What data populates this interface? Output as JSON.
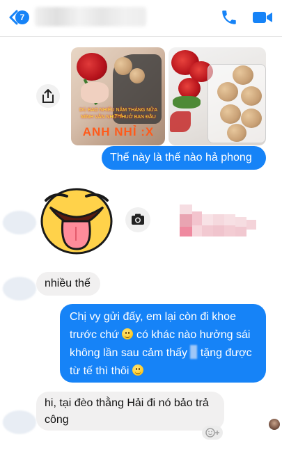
{
  "header": {
    "unread_count": "7",
    "contact_name": "",
    "icons": {
      "back": "chevron-left-icon",
      "call": "phone-icon",
      "video": "video-camera-icon"
    },
    "accent_color": "#1683f7"
  },
  "photo_message": {
    "overlay_line1": "DÙ BAO NHIÊU NĂM THÁNG NỮA THÌ",
    "overlay_line2": "MÌNH VẪN NHƯ THUỞ BAN ĐẦU",
    "overlay_title": "ANH NHỈ :X"
  },
  "messages": [
    {
      "side": "out",
      "text": "Thế này là thế nào hả phong"
    },
    {
      "side": "in",
      "type": "sticker",
      "sticker": "tongue-out-face-sticker"
    },
    {
      "side": "in",
      "text": "nhiều thế"
    },
    {
      "side": "out",
      "line1": "Chị vy gửi đấy, em lại còn đi khoe",
      "line2a": "trước chứ",
      "line2b": "có khác nào hưởng sái",
      "line3a": "không lần sau cảm thấy",
      "line3b": "tặng được",
      "line4": "từ tế thì thôi"
    },
    {
      "side": "in",
      "line1": "hi, tại đèo thằng Hải đi nó bảo trả",
      "line2": "công"
    }
  ],
  "colors": {
    "outgoing": "#1683f7",
    "incoming": "#f1f0f0"
  }
}
